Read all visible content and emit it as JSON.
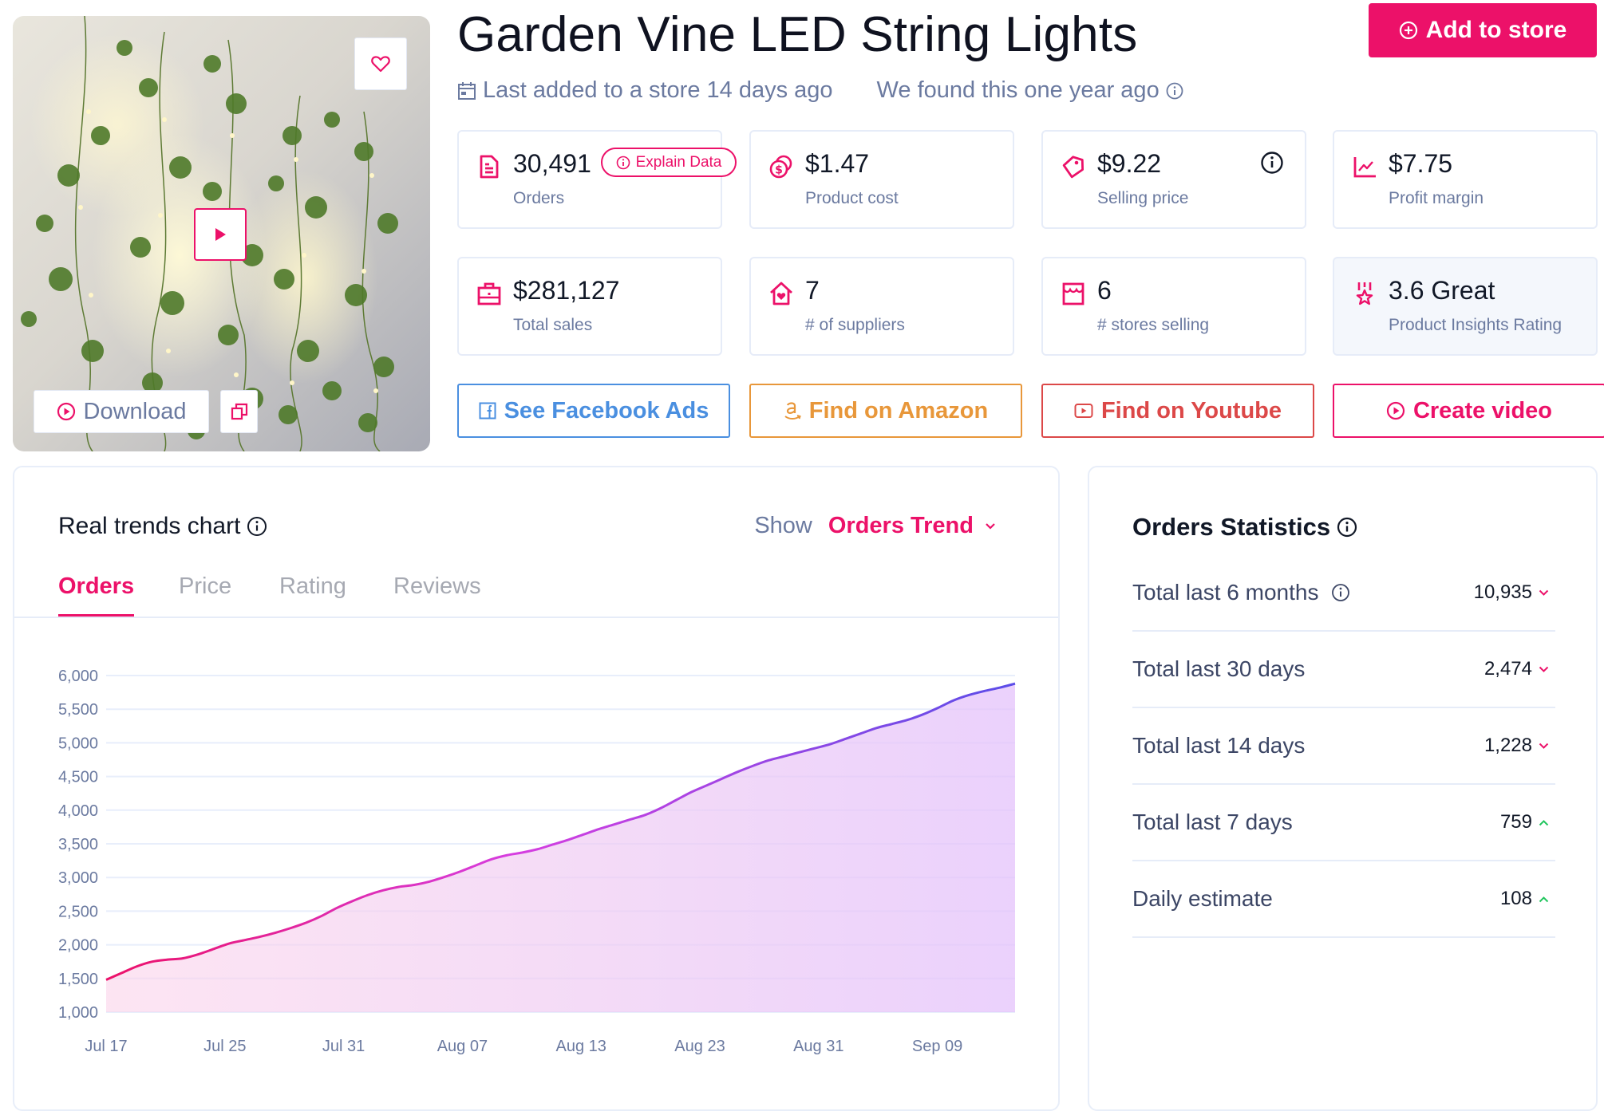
{
  "product": {
    "title": "Garden Vine LED String Lights",
    "last_added": "Last added to a store 14 days ago",
    "found": "We found this one year ago",
    "image_alt": "Garden vine LED string lights on a wall",
    "download_label": "Download"
  },
  "header": {
    "add_to_store_label": "Add to store"
  },
  "stats_cards": [
    {
      "icon": "document-icon",
      "value": "30,491",
      "label": "Orders",
      "badge": "Explain Data"
    },
    {
      "icon": "coins-icon",
      "value": "$1.47",
      "label": "Product cost"
    },
    {
      "icon": "price-tag-icon",
      "value": "$9.22",
      "label": "Selling price",
      "has_info": true
    },
    {
      "icon": "trend-chart-icon",
      "value": "$7.75",
      "label": "Profit margin"
    },
    {
      "icon": "briefcase-icon",
      "value": "$281,127",
      "label": "Total sales"
    },
    {
      "icon": "house-heart-icon",
      "value": "7",
      "label": "# of suppliers"
    },
    {
      "icon": "storefront-icon",
      "value": "6",
      "label": "# stores selling"
    },
    {
      "icon": "award-star-icon",
      "value": "3.6 Great",
      "label": "Product Insights Rating"
    }
  ],
  "actions": [
    {
      "label": "See Facebook Ads",
      "icon": "facebook-icon",
      "color": "#4a8fe0"
    },
    {
      "label": "Find on Amazon",
      "icon": "amazon-icon",
      "color": "#e8973a"
    },
    {
      "label": "Find on Youtube",
      "icon": "youtube-icon",
      "color": "#dc4848"
    },
    {
      "label": "Create video",
      "icon": "play-circle-icon",
      "color": "#ec1169"
    }
  ],
  "chart_panel": {
    "title": "Real trends chart",
    "show_label": "Show",
    "show_value": "Orders Trend",
    "tabs": [
      "Orders",
      "Price",
      "Rating",
      "Reviews"
    ],
    "active_tab": 0
  },
  "chart_data": {
    "type": "area",
    "title": "Orders",
    "xlabel": "",
    "ylabel": "",
    "ylim": [
      1000,
      6000
    ],
    "yticks": [
      1000,
      1500,
      2000,
      2500,
      3000,
      3500,
      4000,
      4500,
      5000,
      5500,
      6000
    ],
    "ytick_labels": [
      "1,000",
      "1,500",
      "2,000",
      "2,500",
      "3,000",
      "3,500",
      "4,000",
      "4,500",
      "5,000",
      "5,500",
      "6,000"
    ],
    "xtick_labels": [
      "Jul 17",
      "Jul 25",
      "Jul 31",
      "Aug 07",
      "Aug 13",
      "Aug 23",
      "Aug 31",
      "Sep 09"
    ],
    "grid": true,
    "legend": "none",
    "series": [
      {
        "name": "Orders",
        "values": [
          1480,
          1580,
          1680,
          1750,
          1780,
          1800,
          1860,
          1940,
          2020,
          2070,
          2120,
          2180,
          2250,
          2330,
          2430,
          2550,
          2650,
          2740,
          2810,
          2860,
          2890,
          2940,
          3010,
          3090,
          3180,
          3270,
          3330,
          3370,
          3420,
          3490,
          3560,
          3640,
          3720,
          3790,
          3860,
          3930,
          4030,
          4150,
          4270,
          4370,
          4470,
          4570,
          4660,
          4740,
          4800,
          4860,
          4920,
          4980,
          5060,
          5140,
          5220,
          5280,
          5340,
          5420,
          5520,
          5630,
          5710,
          5770,
          5820,
          5880
        ]
      }
    ]
  },
  "stats_panel": {
    "title": "Orders Statistics",
    "rows": [
      {
        "label": "Total last 6 months",
        "value": "10,935",
        "trend": "down",
        "has_info": true
      },
      {
        "label": "Total last 30 days",
        "value": "2,474",
        "trend": "down"
      },
      {
        "label": "Total last 14 days",
        "value": "1,228",
        "trend": "down"
      },
      {
        "label": "Total last 7 days",
        "value": "759",
        "trend": "up"
      },
      {
        "label": "Daily estimate",
        "value": "108",
        "trend": "up"
      }
    ]
  },
  "colors": {
    "brand": "#ec1169",
    "muted_text": "#6b7aa0",
    "trend_up": "#22c55e",
    "trend_down": "#ec1169",
    "line_start": "#ec1169",
    "line_end": "#5b4de8"
  }
}
